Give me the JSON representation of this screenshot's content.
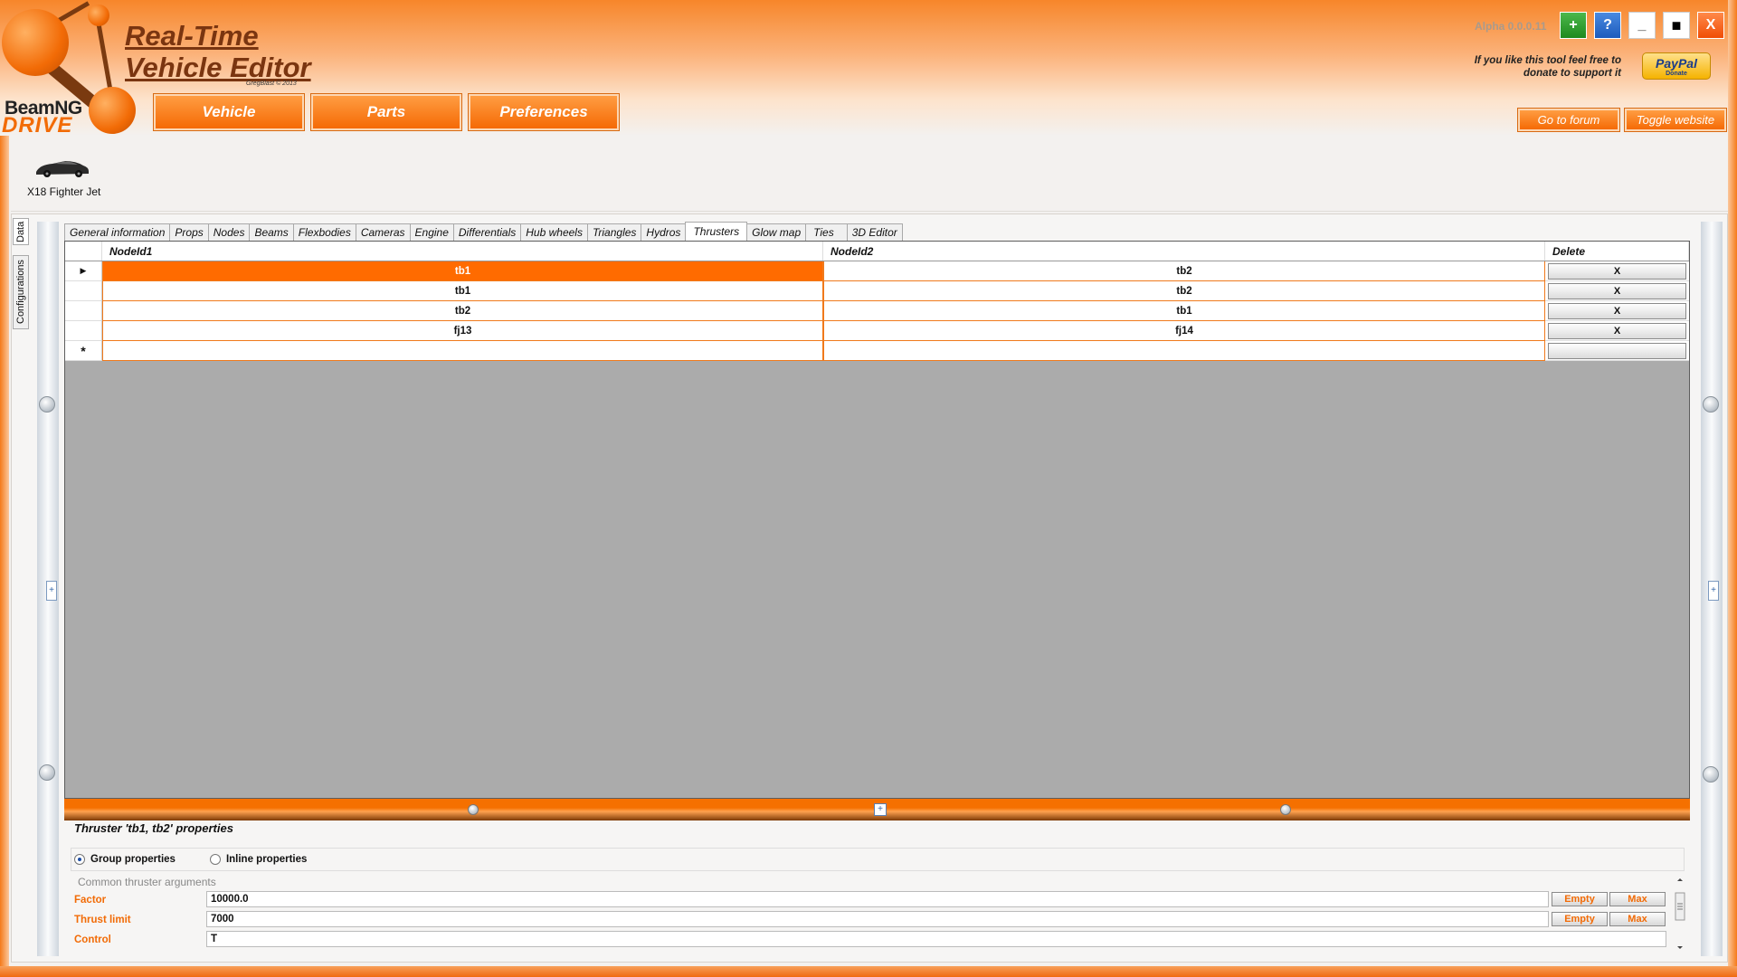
{
  "app": {
    "title_line1": "Real-Time",
    "title_line2": "Vehicle Editor",
    "credit": "GregBlast © 2013",
    "logo_brand": "BeamNG",
    "logo_product": "DRIVE",
    "version": "Alpha 0.0.0.11"
  },
  "nav": {
    "vehicle": "Vehicle",
    "parts": "Parts",
    "preferences": "Preferences"
  },
  "window_buttons": {
    "add": "+",
    "help": "?",
    "minimize": "_",
    "maximize": "■",
    "close": "X"
  },
  "donate": {
    "line1": "If you like this tool feel free to",
    "line2": "donate to support it",
    "paypal": "PayPal",
    "paypal_sub": "Donate"
  },
  "links": {
    "forum": "Go to forum",
    "toggle": "Toggle website"
  },
  "vehicle": {
    "name": "X18 Fighter Jet"
  },
  "side_tabs": [
    "Data",
    "Configurations"
  ],
  "tabs": [
    "General information",
    "Props",
    "Nodes",
    "Beams",
    "Flexbodies",
    "Cameras",
    "Engine",
    "Differentials",
    "Hub wheels",
    "Triangles",
    "Hydros",
    "Thrusters",
    "Glow map",
    "Ties",
    "3D Editor"
  ],
  "active_tab": "Thrusters",
  "grid": {
    "columns": [
      "NodeId1",
      "NodeId2",
      "Delete"
    ],
    "rows": [
      {
        "id1": "tb1",
        "id2": "tb2",
        "delete": "X"
      },
      {
        "id1": "tb1",
        "id2": "tb2",
        "delete": "X"
      },
      {
        "id1": "tb2",
        "id2": "tb1",
        "delete": "X"
      },
      {
        "id1": "fj13",
        "id2": "fj14",
        "delete": "X"
      }
    ],
    "new_row_marker": "*",
    "current_row_marker": "▶"
  },
  "properties": {
    "title": "Thruster 'tb1, tb2' properties",
    "group_option": "Group properties",
    "inline_option": "Inline properties",
    "selected_option": "group",
    "section": "Common thruster arguments",
    "args": [
      {
        "label": "Factor",
        "value": "10000.0",
        "empty": "Empty",
        "max": "Max"
      },
      {
        "label": "Thrust limit",
        "value": "7000",
        "empty": "Empty",
        "max": "Max"
      },
      {
        "label": "Control",
        "value": "T"
      }
    ]
  },
  "colors": {
    "accent": "#f26b06",
    "selected_row": "#ff6b00"
  }
}
